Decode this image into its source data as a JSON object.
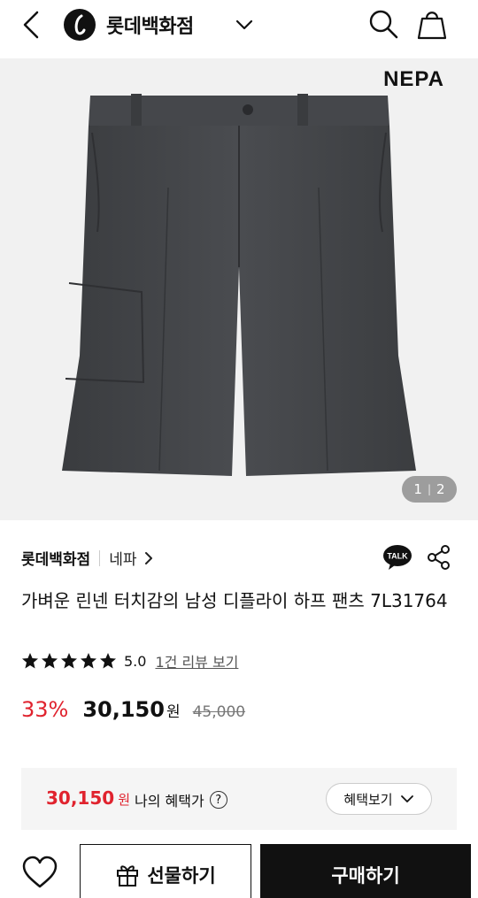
{
  "header": {
    "title": "롯데백화점",
    "icons": [
      "back-arrow-icon",
      "lotte-logo-icon",
      "chevron-down-icon",
      "search-icon",
      "shopping-bag-icon"
    ]
  },
  "gallery": {
    "brand_logo": "NEPA",
    "page_current": "1",
    "page_sep": "|",
    "page_total": "2"
  },
  "product": {
    "store": "롯데백화점",
    "brand": "네파",
    "title": "가벼운 린넨 터치감의 남성 디플라이 하프 팬츠 7L31764",
    "rating": "5.0",
    "stars": 5,
    "review_link": "1건 리뷰 보기",
    "discount": "33%",
    "price": "30,150",
    "currency": "원",
    "original_price": "45,000"
  },
  "benefit": {
    "price": "30,150",
    "currency": "원",
    "label": "나의 혜택가",
    "help": "?",
    "button": "혜택보기"
  },
  "actions": {
    "gift": "선물하기",
    "buy": "구매하기",
    "talk": "TALK"
  },
  "colors": {
    "accent_red": "#e0232e",
    "dark": "#111111"
  }
}
